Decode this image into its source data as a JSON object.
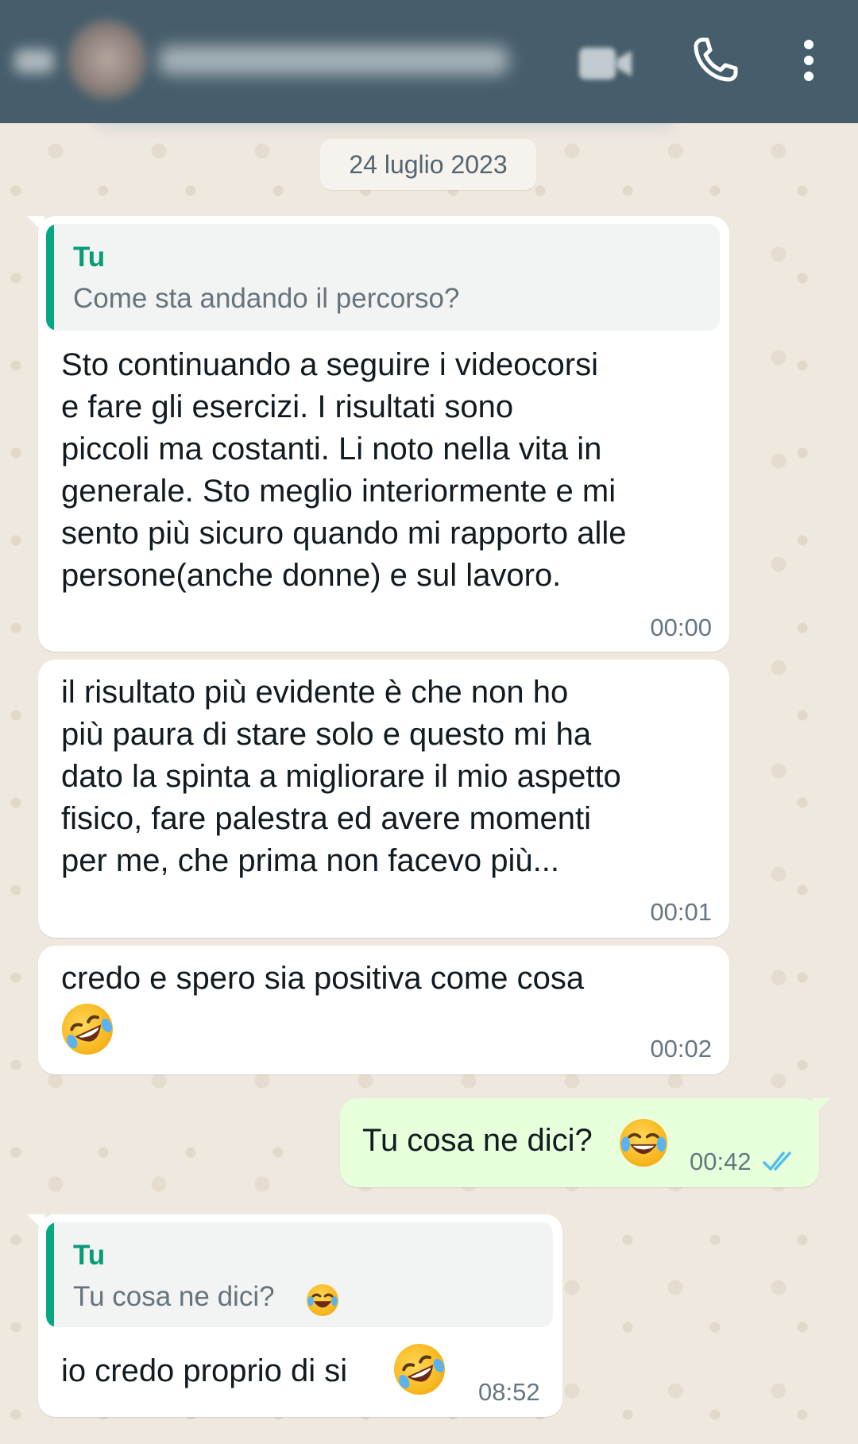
{
  "header": {
    "contact_name_blurred": true,
    "icons": [
      "back-arrow-icon",
      "avatar",
      "video-call-icon",
      "phone-icon",
      "more-options-icon"
    ],
    "bg_color": "#465e6b"
  },
  "chat": {
    "date_chip": "24 luglio 2023",
    "messages": [
      {
        "direction": "in",
        "quote": {
          "author": "Tu",
          "text": "Come sta andando il percorso?"
        },
        "text": "Sto continuando a seguire i videocorsi\ne fare gli esercizi. I risultati sono\npiccoli ma costanti. Li noto nella vita in\ngenerale. Sto meglio interiormente e mi\nsento più sicuro quando mi rapporto alle\npersone(anche donne) e sul lavoro.",
        "time": "00:00"
      },
      {
        "direction": "in",
        "text": "il risultato più evidente è che non ho\npiù paura di stare solo e questo mi ha\ndato la spinta a migliorare il mio aspetto\nfisico, fare palestra ed avere momenti\nper me, che prima non facevo più...",
        "time": "00:01"
      },
      {
        "direction": "in",
        "text": "credo e spero sia positiva come cosa",
        "emoji": "rolling-on-floor-laughing-emoji",
        "time": "00:02"
      },
      {
        "direction": "out",
        "text": "Tu cosa ne dici?",
        "emoji": "tears-of-joy-emoji",
        "time": "00:42",
        "status": "read",
        "status_color": "#53bdeb"
      },
      {
        "direction": "in",
        "quote": {
          "author": "Tu",
          "text": "Tu cosa ne dici?",
          "emoji": "tears-of-joy-emoji"
        },
        "text": "io credo proprio di si",
        "emoji": "rolling-on-floor-laughing-emoji",
        "time": "08:52"
      }
    ]
  },
  "colors": {
    "wallpaper": "#efe8de",
    "incoming_bubble": "#ffffff",
    "outgoing_bubble": "#e7ffdb",
    "quote_accent": "#06a884",
    "quote_author": "#079b77"
  }
}
